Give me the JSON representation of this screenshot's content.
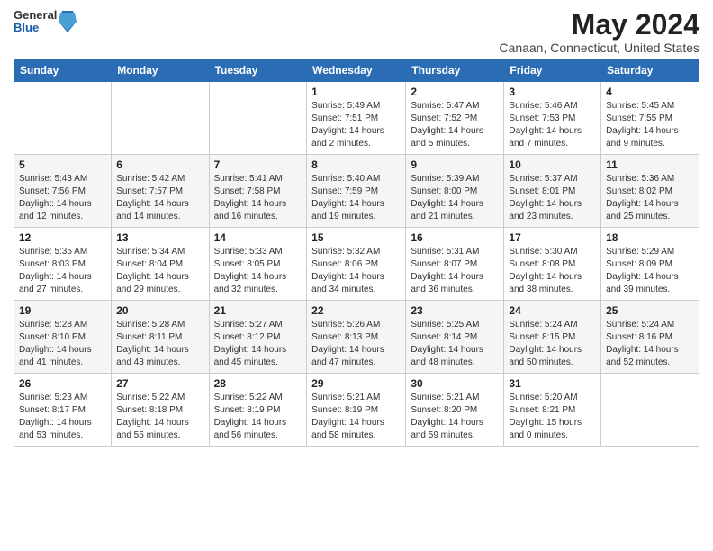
{
  "logo": {
    "general": "General",
    "blue": "Blue"
  },
  "header": {
    "month_title": "May 2024",
    "location": "Canaan, Connecticut, United States"
  },
  "weekdays": [
    "Sunday",
    "Monday",
    "Tuesday",
    "Wednesday",
    "Thursday",
    "Friday",
    "Saturday"
  ],
  "weeks": [
    [
      {
        "day": "",
        "info": ""
      },
      {
        "day": "",
        "info": ""
      },
      {
        "day": "",
        "info": ""
      },
      {
        "day": "1",
        "info": "Sunrise: 5:49 AM\nSunset: 7:51 PM\nDaylight: 14 hours\nand 2 minutes."
      },
      {
        "day": "2",
        "info": "Sunrise: 5:47 AM\nSunset: 7:52 PM\nDaylight: 14 hours\nand 5 minutes."
      },
      {
        "day": "3",
        "info": "Sunrise: 5:46 AM\nSunset: 7:53 PM\nDaylight: 14 hours\nand 7 minutes."
      },
      {
        "day": "4",
        "info": "Sunrise: 5:45 AM\nSunset: 7:55 PM\nDaylight: 14 hours\nand 9 minutes."
      }
    ],
    [
      {
        "day": "5",
        "info": "Sunrise: 5:43 AM\nSunset: 7:56 PM\nDaylight: 14 hours\nand 12 minutes."
      },
      {
        "day": "6",
        "info": "Sunrise: 5:42 AM\nSunset: 7:57 PM\nDaylight: 14 hours\nand 14 minutes."
      },
      {
        "day": "7",
        "info": "Sunrise: 5:41 AM\nSunset: 7:58 PM\nDaylight: 14 hours\nand 16 minutes."
      },
      {
        "day": "8",
        "info": "Sunrise: 5:40 AM\nSunset: 7:59 PM\nDaylight: 14 hours\nand 19 minutes."
      },
      {
        "day": "9",
        "info": "Sunrise: 5:39 AM\nSunset: 8:00 PM\nDaylight: 14 hours\nand 21 minutes."
      },
      {
        "day": "10",
        "info": "Sunrise: 5:37 AM\nSunset: 8:01 PM\nDaylight: 14 hours\nand 23 minutes."
      },
      {
        "day": "11",
        "info": "Sunrise: 5:36 AM\nSunset: 8:02 PM\nDaylight: 14 hours\nand 25 minutes."
      }
    ],
    [
      {
        "day": "12",
        "info": "Sunrise: 5:35 AM\nSunset: 8:03 PM\nDaylight: 14 hours\nand 27 minutes."
      },
      {
        "day": "13",
        "info": "Sunrise: 5:34 AM\nSunset: 8:04 PM\nDaylight: 14 hours\nand 29 minutes."
      },
      {
        "day": "14",
        "info": "Sunrise: 5:33 AM\nSunset: 8:05 PM\nDaylight: 14 hours\nand 32 minutes."
      },
      {
        "day": "15",
        "info": "Sunrise: 5:32 AM\nSunset: 8:06 PM\nDaylight: 14 hours\nand 34 minutes."
      },
      {
        "day": "16",
        "info": "Sunrise: 5:31 AM\nSunset: 8:07 PM\nDaylight: 14 hours\nand 36 minutes."
      },
      {
        "day": "17",
        "info": "Sunrise: 5:30 AM\nSunset: 8:08 PM\nDaylight: 14 hours\nand 38 minutes."
      },
      {
        "day": "18",
        "info": "Sunrise: 5:29 AM\nSunset: 8:09 PM\nDaylight: 14 hours\nand 39 minutes."
      }
    ],
    [
      {
        "day": "19",
        "info": "Sunrise: 5:28 AM\nSunset: 8:10 PM\nDaylight: 14 hours\nand 41 minutes."
      },
      {
        "day": "20",
        "info": "Sunrise: 5:28 AM\nSunset: 8:11 PM\nDaylight: 14 hours\nand 43 minutes."
      },
      {
        "day": "21",
        "info": "Sunrise: 5:27 AM\nSunset: 8:12 PM\nDaylight: 14 hours\nand 45 minutes."
      },
      {
        "day": "22",
        "info": "Sunrise: 5:26 AM\nSunset: 8:13 PM\nDaylight: 14 hours\nand 47 minutes."
      },
      {
        "day": "23",
        "info": "Sunrise: 5:25 AM\nSunset: 8:14 PM\nDaylight: 14 hours\nand 48 minutes."
      },
      {
        "day": "24",
        "info": "Sunrise: 5:24 AM\nSunset: 8:15 PM\nDaylight: 14 hours\nand 50 minutes."
      },
      {
        "day": "25",
        "info": "Sunrise: 5:24 AM\nSunset: 8:16 PM\nDaylight: 14 hours\nand 52 minutes."
      }
    ],
    [
      {
        "day": "26",
        "info": "Sunrise: 5:23 AM\nSunset: 8:17 PM\nDaylight: 14 hours\nand 53 minutes."
      },
      {
        "day": "27",
        "info": "Sunrise: 5:22 AM\nSunset: 8:18 PM\nDaylight: 14 hours\nand 55 minutes."
      },
      {
        "day": "28",
        "info": "Sunrise: 5:22 AM\nSunset: 8:19 PM\nDaylight: 14 hours\nand 56 minutes."
      },
      {
        "day": "29",
        "info": "Sunrise: 5:21 AM\nSunset: 8:19 PM\nDaylight: 14 hours\nand 58 minutes."
      },
      {
        "day": "30",
        "info": "Sunrise: 5:21 AM\nSunset: 8:20 PM\nDaylight: 14 hours\nand 59 minutes."
      },
      {
        "day": "31",
        "info": "Sunrise: 5:20 AM\nSunset: 8:21 PM\nDaylight: 15 hours\nand 0 minutes."
      },
      {
        "day": "",
        "info": ""
      }
    ]
  ]
}
